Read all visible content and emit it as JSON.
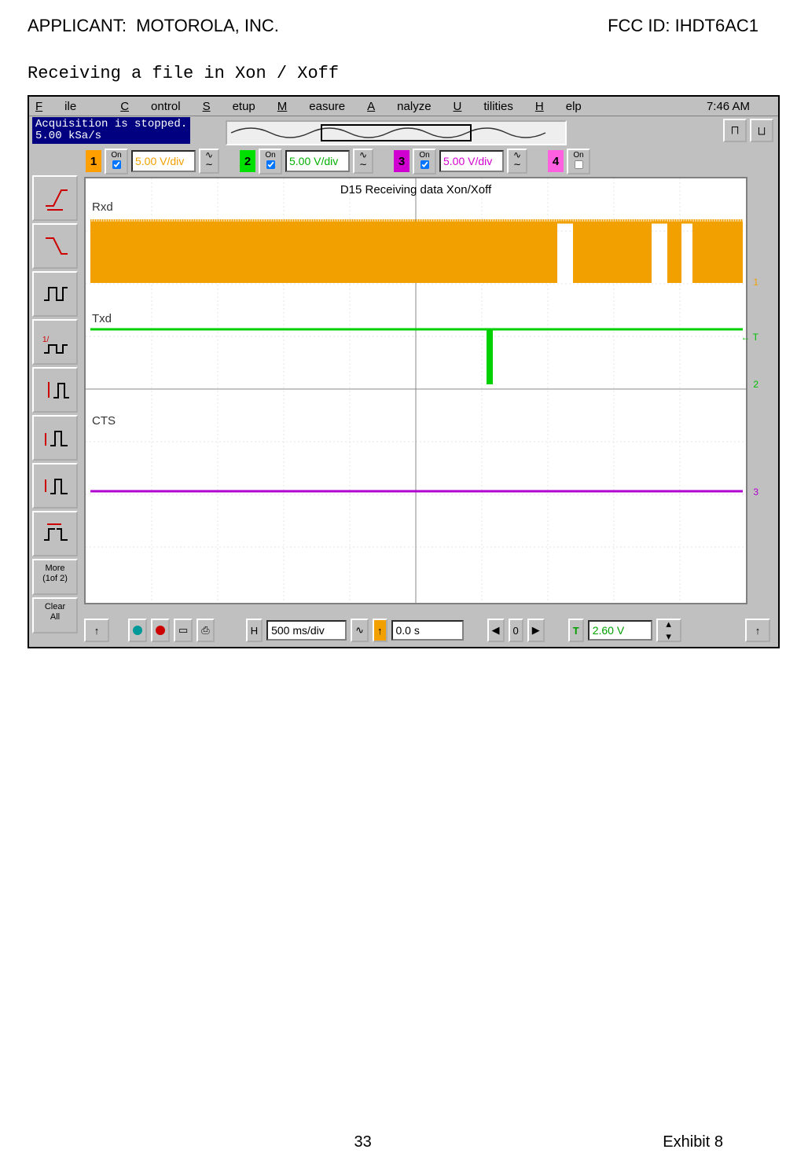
{
  "header": {
    "applicant_label": "APPLICANT:  ",
    "applicant": "MOTOROLA, INC.",
    "fcc_label": "FCC ID: ",
    "fcc": "IHDT6AC1"
  },
  "subtitle": "Receiving a file in Xon / Xoff",
  "menu": {
    "file": "File",
    "control": "Control",
    "setup": "Setup",
    "measure": "Measure",
    "analyze": "Analyze",
    "utilities": "Utilities",
    "help": "Help",
    "time": "7:46 AM"
  },
  "status": {
    "line1": "Acquisition is stopped.",
    "line2": "5.00 kSa/s"
  },
  "channels": {
    "on": "On",
    "c1": {
      "v": "5.00 V/div"
    },
    "c2": {
      "v": "5.00 V/div"
    },
    "c3": {
      "v": "5.00 V/div"
    },
    "c4": {
      "v": ""
    }
  },
  "graph": {
    "title": "D15 Receiving data Xon/Xoff",
    "rxd": "Rxd",
    "txd": "Txd",
    "cts": "CTS",
    "m1": "1",
    "m2": "2",
    "m3": "3",
    "mt": "← T"
  },
  "tools": {
    "more": "More\n(1of 2)",
    "clear": "Clear\nAll"
  },
  "bottom": {
    "h": "H",
    "hval": "500 ms/div",
    "delay": "0.0 s",
    "t": "T",
    "tval": "2.60 V",
    "zero": "0",
    "left": "◀",
    "right": "▶"
  },
  "footer": {
    "page": "33",
    "exhibit": "Exhibit 8"
  },
  "chart_data": {
    "type": "line",
    "title": "D15 Receiving data Xon/Xoff",
    "timebase_s_per_div": 0.5,
    "x_range_s": [
      -2.5,
      2.5
    ],
    "vertical_v_per_div": 5.0,
    "trigger_level_v": 2.6,
    "sample_rate": "5.00 kSa/s",
    "series": [
      {
        "name": "Rxd",
        "color": "#f2a000",
        "description": "Continuous high-frequency toggling (dense data burst) across full window forming a solid band roughly 0 V to 5 V; brief gaps (idle high) near approx +1.0 s and +1.7 s to +1.9 s"
      },
      {
        "name": "Txd",
        "color": "#00d000",
        "description": "Idle high near 5 V across entire window; single narrow low pulse near approx +0.55 s"
      },
      {
        "name": "CTS",
        "color": "#b000d0",
        "description": "Flat line near 0 V for entire window (inactive)"
      }
    ]
  }
}
